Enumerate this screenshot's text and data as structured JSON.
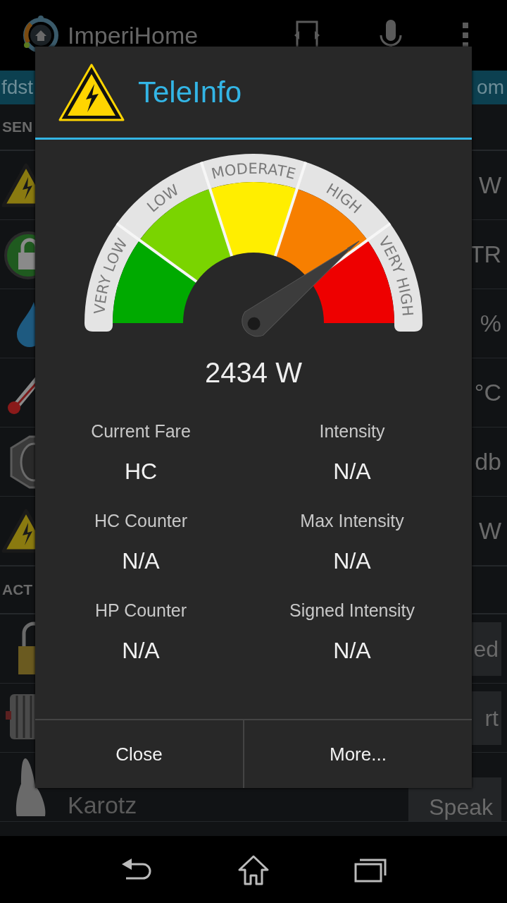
{
  "app_bar": {
    "title": "ImperiHome"
  },
  "tab_strip": {
    "left_text": "fdst",
    "right_text": "om"
  },
  "sensor_section": {
    "header": "SEN",
    "rows": [
      {
        "value": "W"
      },
      {
        "value": "TR"
      },
      {
        "value": "%"
      },
      {
        "value": "°C"
      },
      {
        "value": "db"
      },
      {
        "value": "W"
      }
    ]
  },
  "action_section": {
    "header": "ACT",
    "rows": [
      {
        "button": "ed"
      },
      {
        "button": "rt"
      },
      {
        "name": "Karotz",
        "button": "Speak"
      }
    ]
  },
  "dialog": {
    "title": "TeleInfo",
    "gauge": {
      "level": 0.79,
      "segments": [
        {
          "label": "VERY LOW",
          "color": "#00aa00"
        },
        {
          "label": "LOW",
          "color": "#7ad400"
        },
        {
          "label": "MODERATE",
          "color": "#ffee00"
        },
        {
          "label": "HIGH",
          "color": "#f77f00"
        },
        {
          "label": "VERY HIGH",
          "color": "#ee0000"
        }
      ]
    },
    "reading": "2434 W",
    "fields": [
      {
        "label": "Current Fare",
        "value": "HC"
      },
      {
        "label": "Intensity",
        "value": "N/A"
      },
      {
        "label": "HC Counter",
        "value": "N/A"
      },
      {
        "label": "Max Intensity",
        "value": "N/A"
      },
      {
        "label": "HP Counter",
        "value": "N/A"
      },
      {
        "label": "Signed Intensity",
        "value": "N/A"
      }
    ],
    "buttons": [
      "Close",
      "More..."
    ]
  }
}
